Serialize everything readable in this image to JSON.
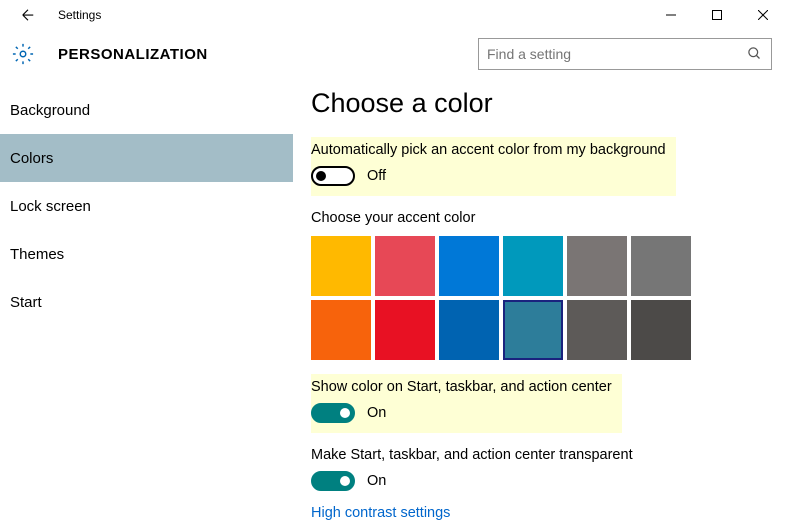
{
  "window": {
    "title": "Settings"
  },
  "header": {
    "title": "PERSONALIZATION",
    "search_placeholder": "Find a setting"
  },
  "sidebar": {
    "items": [
      {
        "label": "Background",
        "selected": false
      },
      {
        "label": "Colors",
        "selected": true
      },
      {
        "label": "Lock screen",
        "selected": false
      },
      {
        "label": "Themes",
        "selected": false
      },
      {
        "label": "Start",
        "selected": false
      }
    ]
  },
  "main": {
    "heading": "Choose a color",
    "auto_pick": {
      "label": "Automatically pick an accent color from my background",
      "state": "Off"
    },
    "accent_label": "Choose your accent color",
    "colors_row1": [
      "#FFB900",
      "#E74856",
      "#0078D7",
      "#0099BC",
      "#7A7574",
      "#767676"
    ],
    "colors_row2": [
      "#F7630C",
      "#E81123",
      "#0063B1",
      "#2D7D9A",
      "#5D5A58",
      "#4C4A48"
    ],
    "selected_color_index": 9,
    "show_color": {
      "label": "Show color on Start, taskbar, and action center",
      "state": "On"
    },
    "transparent": {
      "label": "Make Start, taskbar, and action center transparent",
      "state": "On"
    },
    "link": "High contrast settings"
  }
}
